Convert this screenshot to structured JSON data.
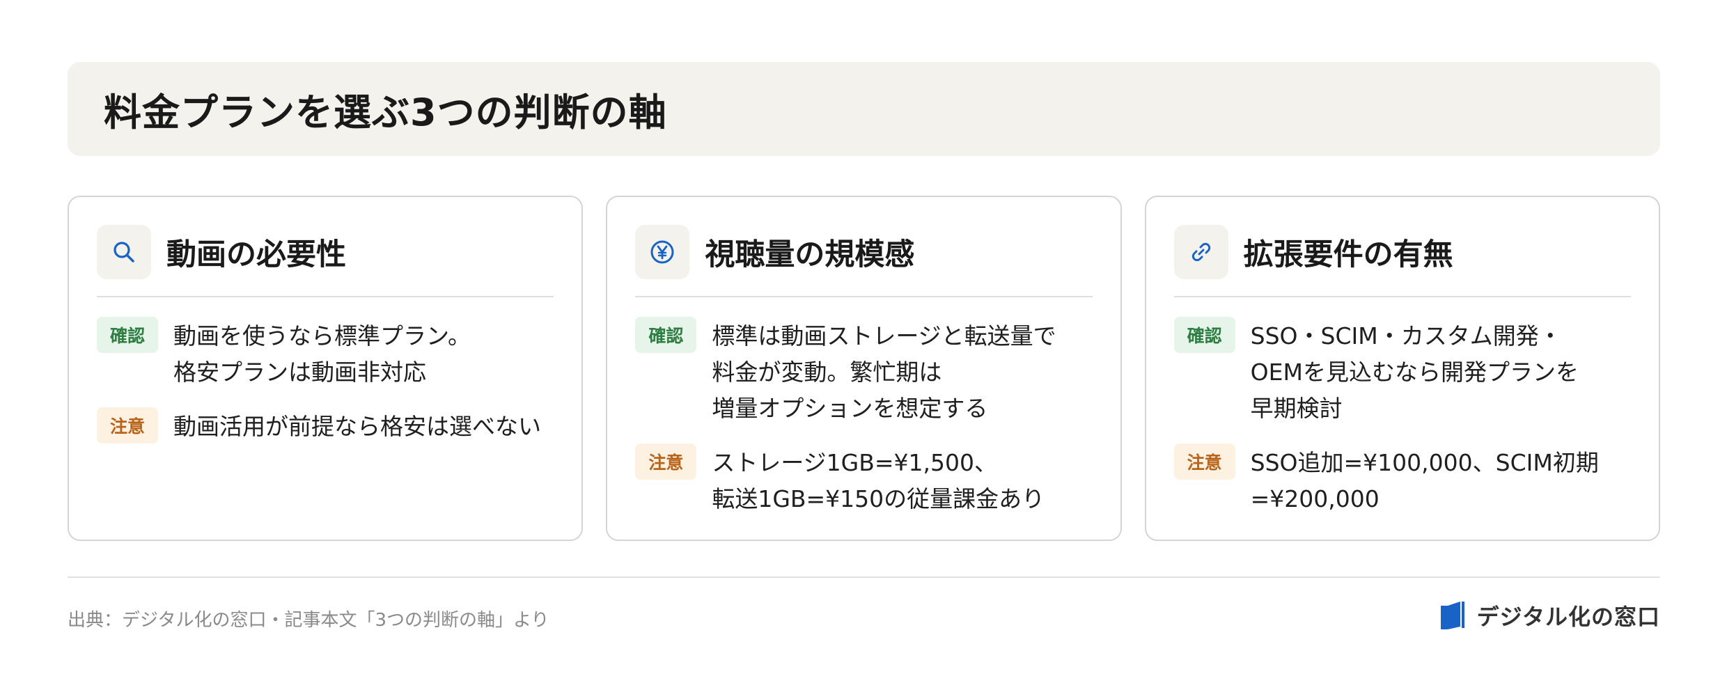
{
  "title": "料金プランを選ぶ3つの判断の軸",
  "cards": [
    {
      "icon": "search-icon",
      "heading": "動画の必要性",
      "rows": [
        {
          "badge": "確認",
          "type": "ok",
          "text": "動画を使うなら標準プラン。\n格安プランは動画非対応"
        },
        {
          "badge": "注意",
          "type": "warn",
          "text": "動画活用が前提なら格安は選べない"
        }
      ]
    },
    {
      "icon": "yen-icon",
      "heading": "視聴量の規模感",
      "rows": [
        {
          "badge": "確認",
          "type": "ok",
          "text": "標準は動画ストレージと転送量で\n料金が変動。繁忙期は\n増量オプションを想定する"
        },
        {
          "badge": "注意",
          "type": "warn",
          "text": "ストレージ1GB=¥1,500、\n転送1GB=¥150の従量課金あり"
        }
      ]
    },
    {
      "icon": "link-icon",
      "heading": "拡張要件の有無",
      "rows": [
        {
          "badge": "確認",
          "type": "ok",
          "text": "SSO・SCIM・カスタム開発・\nOEMを見込むなら開発プランを\n早期検討"
        },
        {
          "badge": "注意",
          "type": "warn",
          "text": "SSO追加=¥100,000、SCIM初期\n=¥200,000"
        }
      ]
    }
  ],
  "footer": {
    "source": "出典：デジタル化の窓口・記事本文「3つの判断の軸」より",
    "brand": "デジタル化の窓口"
  },
  "colors": {
    "accent_blue": "#1a63c6",
    "ok_badge": "#2e7d42",
    "warn_badge": "#b8641a"
  }
}
